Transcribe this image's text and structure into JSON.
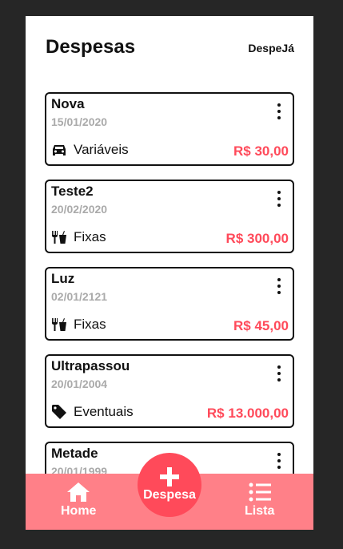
{
  "header": {
    "title": "Despesas",
    "brand": "DespeJá"
  },
  "expenses": [
    {
      "name": "Nova",
      "date": "15/01/2020",
      "category": "Variáveis",
      "icon": "car-icon",
      "amount": "R$ 30,00"
    },
    {
      "name": "Teste2",
      "date": "20/02/2020",
      "category": "Fixas",
      "icon": "utensils-icon",
      "amount": "R$ 300,00"
    },
    {
      "name": "Luz",
      "date": "02/01/2121",
      "category": "Fixas",
      "icon": "utensils-icon",
      "amount": "R$ 45,00"
    },
    {
      "name": "Ultrapassou",
      "date": "20/01/2004",
      "category": "Eventuais",
      "icon": "tag-icon",
      "amount": "R$ 13.000,00"
    },
    {
      "name": "Metade",
      "date": "20/01/1999",
      "category": "",
      "icon": "",
      "amount": ""
    }
  ],
  "nav": {
    "home": "Home",
    "add": "Despesa",
    "list": "Lista"
  },
  "colors": {
    "accent": "#ff4a5a",
    "navbar": "#ff8088"
  }
}
